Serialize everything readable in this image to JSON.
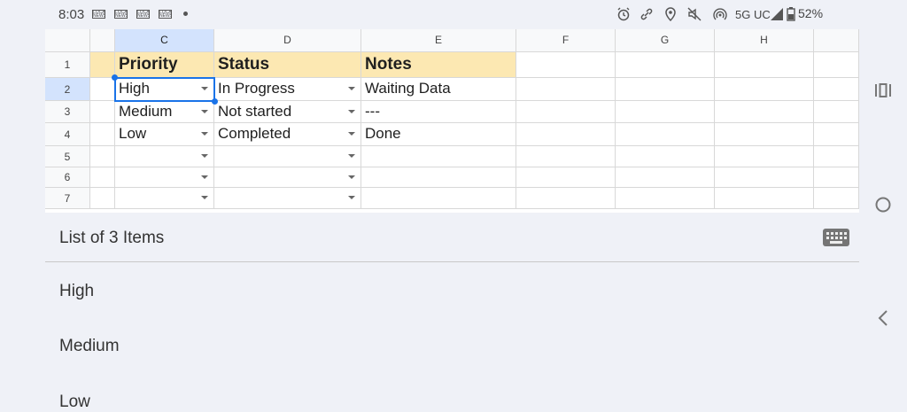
{
  "status_bar": {
    "time": "8:03",
    "news_icon_text": "LOCAL NEWS",
    "network": "5G UC",
    "battery": "52%"
  },
  "sheet": {
    "columns": [
      "C",
      "D",
      "E",
      "F",
      "G",
      "H"
    ],
    "rows": [
      "1",
      "2",
      "3",
      "4",
      "5",
      "6",
      "7"
    ],
    "headers": {
      "priority": "Priority",
      "status": "Status",
      "notes": "Notes"
    },
    "data": [
      {
        "priority": "High",
        "status": "In Progress",
        "notes": "Waiting Data"
      },
      {
        "priority": "Medium",
        "status": "Not started",
        "notes": "---"
      },
      {
        "priority": "Low",
        "status": "Completed",
        "notes": "Done"
      }
    ],
    "colors": {
      "header_fill": "#fce8b2",
      "selection": "#1a73e8",
      "selected_header": "#d3e3fd"
    }
  },
  "picker": {
    "title": "List of 3 Items",
    "options": [
      "High",
      "Medium",
      "Low"
    ]
  }
}
